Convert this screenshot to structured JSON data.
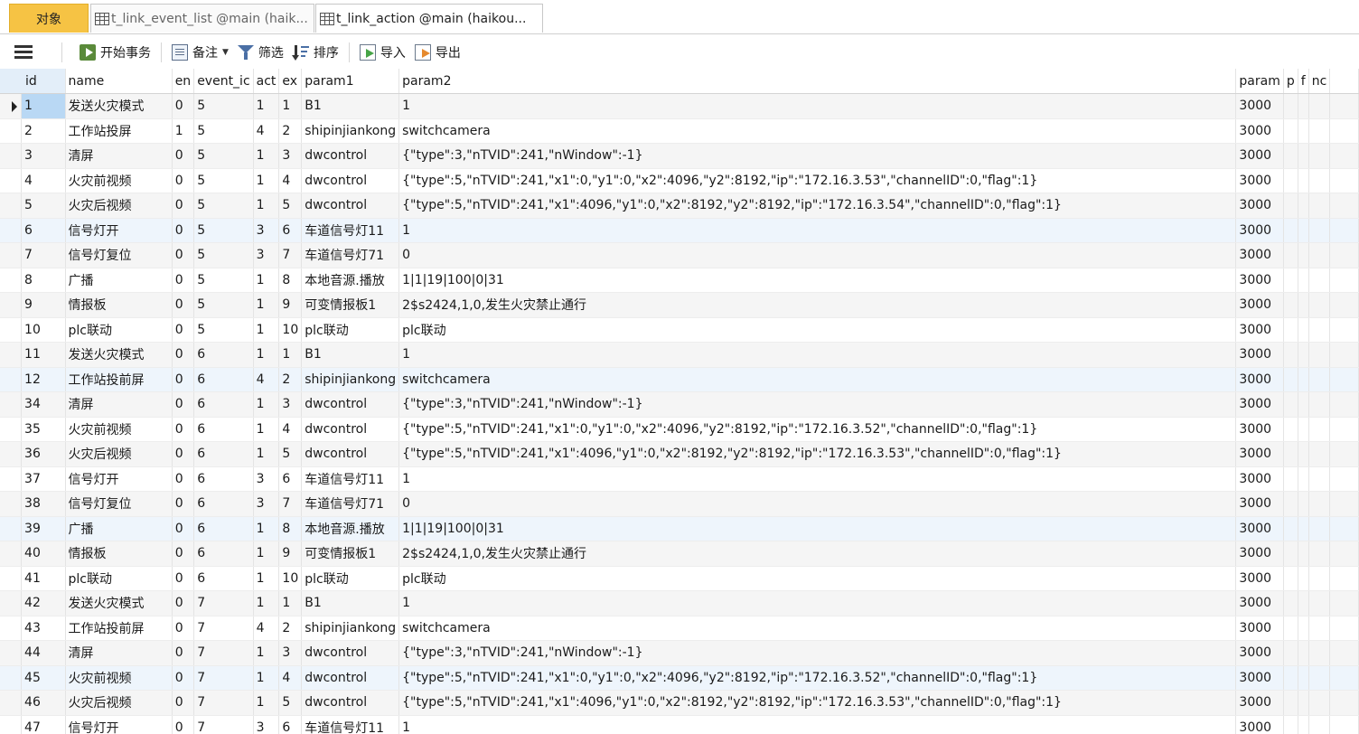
{
  "tabs": [
    {
      "label": "对象"
    },
    {
      "label": "t_link_event_list @main (haik..."
    },
    {
      "label": "t_link_action @main (haikou..."
    }
  ],
  "toolbar": {
    "begin_transaction": "开始事务",
    "memo": "备注",
    "filter": "筛选",
    "sort": "排序",
    "import": "导入",
    "export": "导出"
  },
  "columns": [
    "id",
    "name",
    "en",
    "event_ic",
    "act",
    "ex",
    "param1",
    "param2",
    "param",
    "p",
    "f",
    "nc"
  ],
  "rows": [
    {
      "id": "1",
      "name": "发送火灾模式",
      "en": "0",
      "event": "5",
      "act": "1",
      "ex": "1",
      "param1": "B1",
      "param2": "1",
      "param3": "3000"
    },
    {
      "id": "2",
      "name": "工作站投屏",
      "en": "1",
      "event": "5",
      "act": "4",
      "ex": "2",
      "param1": "shipinjiankong",
      "param2": "switchcamera",
      "param3": "3000"
    },
    {
      "id": "3",
      "name": "清屏",
      "en": "0",
      "event": "5",
      "act": "1",
      "ex": "3",
      "param1": "dwcontrol",
      "param2": "{\"type\":3,\"nTVID\":241,\"nWindow\":-1}",
      "param3": "3000"
    },
    {
      "id": "4",
      "name": "火灾前视频",
      "en": "0",
      "event": "5",
      "act": "1",
      "ex": "4",
      "param1": "dwcontrol",
      "param2": "{\"type\":5,\"nTVID\":241,\"x1\":0,\"y1\":0,\"x2\":4096,\"y2\":8192,\"ip\":\"172.16.3.53\",\"channelID\":0,\"flag\":1}",
      "param3": "3000"
    },
    {
      "id": "5",
      "name": "火灾后视频",
      "en": "0",
      "event": "5",
      "act": "1",
      "ex": "5",
      "param1": "dwcontrol",
      "param2": "{\"type\":5,\"nTVID\":241,\"x1\":4096,\"y1\":0,\"x2\":8192,\"y2\":8192,\"ip\":\"172.16.3.54\",\"channelID\":0,\"flag\":1}",
      "param3": "3000"
    },
    {
      "id": "6",
      "name": "信号灯开",
      "en": "0",
      "event": "5",
      "act": "3",
      "ex": "6",
      "param1": "车道信号灯11",
      "param2": "1",
      "param3": "3000"
    },
    {
      "id": "7",
      "name": "信号灯复位",
      "en": "0",
      "event": "5",
      "act": "3",
      "ex": "7",
      "param1": "车道信号灯71",
      "param2": "0",
      "param3": "3000"
    },
    {
      "id": "8",
      "name": "广播",
      "en": "0",
      "event": "5",
      "act": "1",
      "ex": "8",
      "param1": "本地音源.播放",
      "param2": "1|1|19|100|0|31",
      "param3": "3000"
    },
    {
      "id": "9",
      "name": "情报板",
      "en": "0",
      "event": "5",
      "act": "1",
      "ex": "9",
      "param1": "可变情报板1",
      "param2": "2$s2424,1,0,发生火灾禁止通行",
      "param3": "3000"
    },
    {
      "id": "10",
      "name": "plc联动",
      "en": "0",
      "event": "5",
      "act": "1",
      "ex": "10",
      "param1": "plc联动",
      "param2": "plc联动",
      "param3": "3000"
    },
    {
      "id": "11",
      "name": "发送火灾模式",
      "en": "0",
      "event": "6",
      "act": "1",
      "ex": "1",
      "param1": "B1",
      "param2": "1",
      "param3": "3000"
    },
    {
      "id": "12",
      "name": "工作站投前屏",
      "en": "0",
      "event": "6",
      "act": "4",
      "ex": "2",
      "param1": "shipinjiankong",
      "param2": "switchcamera",
      "param3": "3000"
    },
    {
      "id": "34",
      "name": "清屏",
      "en": "0",
      "event": "6",
      "act": "1",
      "ex": "3",
      "param1": "dwcontrol",
      "param2": "{\"type\":3,\"nTVID\":241,\"nWindow\":-1}",
      "param3": "3000"
    },
    {
      "id": "35",
      "name": "火灾前视频",
      "en": "0",
      "event": "6",
      "act": "1",
      "ex": "4",
      "param1": "dwcontrol",
      "param2": "{\"type\":5,\"nTVID\":241,\"x1\":0,\"y1\":0,\"x2\":4096,\"y2\":8192,\"ip\":\"172.16.3.52\",\"channelID\":0,\"flag\":1}",
      "param3": "3000"
    },
    {
      "id": "36",
      "name": "火灾后视频",
      "en": "0",
      "event": "6",
      "act": "1",
      "ex": "5",
      "param1": "dwcontrol",
      "param2": "{\"type\":5,\"nTVID\":241,\"x1\":4096,\"y1\":0,\"x2\":8192,\"y2\":8192,\"ip\":\"172.16.3.53\",\"channelID\":0,\"flag\":1}",
      "param3": "3000"
    },
    {
      "id": "37",
      "name": "信号灯开",
      "en": "0",
      "event": "6",
      "act": "3",
      "ex": "6",
      "param1": "车道信号灯11",
      "param2": "1",
      "param3": "3000"
    },
    {
      "id": "38",
      "name": "信号灯复位",
      "en": "0",
      "event": "6",
      "act": "3",
      "ex": "7",
      "param1": "车道信号灯71",
      "param2": "0",
      "param3": "3000"
    },
    {
      "id": "39",
      "name": "广播",
      "en": "0",
      "event": "6",
      "act": "1",
      "ex": "8",
      "param1": "本地音源.播放",
      "param2": "1|1|19|100|0|31",
      "param3": "3000"
    },
    {
      "id": "40",
      "name": "情报板",
      "en": "0",
      "event": "6",
      "act": "1",
      "ex": "9",
      "param1": "可变情报板1",
      "param2": "2$s2424,1,0,发生火灾禁止通行",
      "param3": "3000"
    },
    {
      "id": "41",
      "name": "plc联动",
      "en": "0",
      "event": "6",
      "act": "1",
      "ex": "10",
      "param1": "plc联动",
      "param2": "plc联动",
      "param3": "3000"
    },
    {
      "id": "42",
      "name": "发送火灾模式",
      "en": "0",
      "event": "7",
      "act": "1",
      "ex": "1",
      "param1": "B1",
      "param2": "1",
      "param3": "3000"
    },
    {
      "id": "43",
      "name": "工作站投前屏",
      "en": "0",
      "event": "7",
      "act": "4",
      "ex": "2",
      "param1": "shipinjiankong",
      "param2": "switchcamera",
      "param3": "3000"
    },
    {
      "id": "44",
      "name": "清屏",
      "en": "0",
      "event": "7",
      "act": "1",
      "ex": "3",
      "param1": "dwcontrol",
      "param2": "{\"type\":3,\"nTVID\":241,\"nWindow\":-1}",
      "param3": "3000"
    },
    {
      "id": "45",
      "name": "火灾前视频",
      "en": "0",
      "event": "7",
      "act": "1",
      "ex": "4",
      "param1": "dwcontrol",
      "param2": "{\"type\":5,\"nTVID\":241,\"x1\":0,\"y1\":0,\"x2\":4096,\"y2\":8192,\"ip\":\"172.16.3.52\",\"channelID\":0,\"flag\":1}",
      "param3": "3000"
    },
    {
      "id": "46",
      "name": "火灾后视频",
      "en": "0",
      "event": "7",
      "act": "1",
      "ex": "5",
      "param1": "dwcontrol",
      "param2": "{\"type\":5,\"nTVID\":241,\"x1\":4096,\"y1\":0,\"x2\":8192,\"y2\":8192,\"ip\":\"172.16.3.53\",\"channelID\":0,\"flag\":1}",
      "param3": "3000"
    },
    {
      "id": "47",
      "name": "信号灯开",
      "en": "0",
      "event": "7",
      "act": "3",
      "ex": "6",
      "param1": "车道信号灯11",
      "param2": "1",
      "param3": "3000"
    }
  ]
}
